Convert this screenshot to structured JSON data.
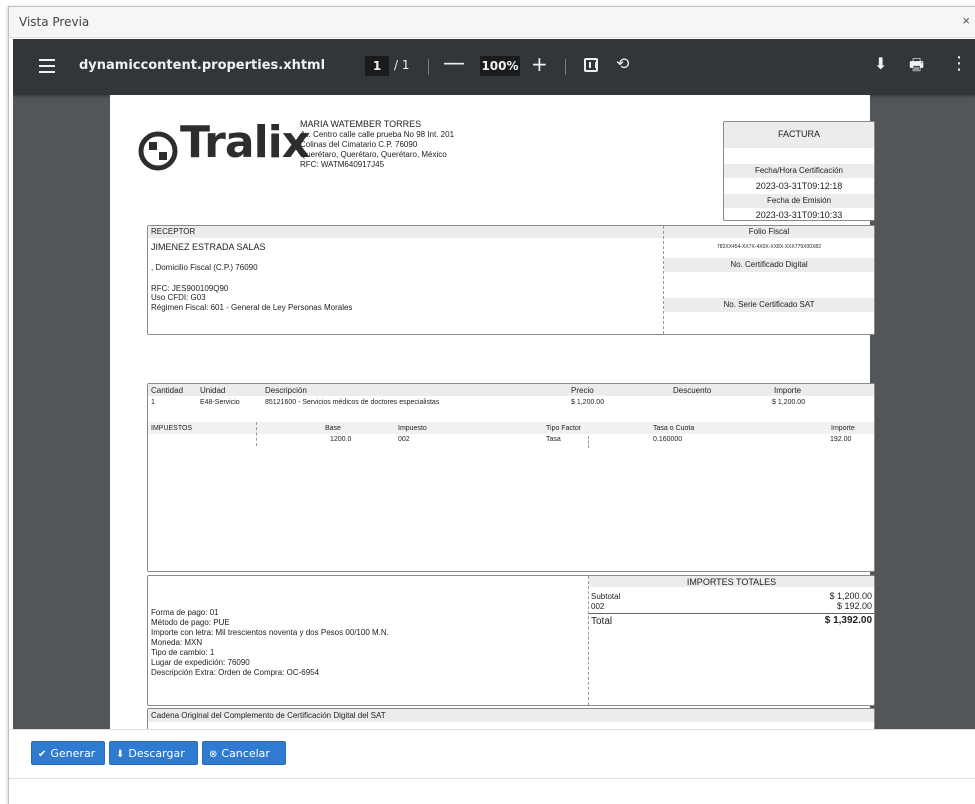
{
  "dialog": {
    "title": "Vista Previa",
    "close": "×"
  },
  "viewer": {
    "doc_name": "dynamiccontent.properties.xhtml",
    "page_current": "1",
    "page_total": "/ 1",
    "zoom": "100%",
    "zoom_out": "—",
    "zoom_in": "+",
    "rotate": "⟲",
    "download": "⬇",
    "print": "🖶",
    "more": "⋮"
  },
  "invoice": {
    "logo_text": "Tralix",
    "issuer": {
      "name": "MARIA WATEMBER TORRES",
      "line1": "Av. Centro calle calle prueba No 98 Int. 201",
      "line2": "Colinas del Cimatario C.P. 76090",
      "line3": "Querétaro, Querétaro, Querétaro, México",
      "rfc": "RFC: WATM640917J45"
    },
    "factura_box": {
      "title": "FACTURA",
      "cert_label": "Fecha/Hora Certificación",
      "cert_value": "2023-03-31T09:12:18",
      "emision_label": "Fecha de Emisión",
      "emision_value": "2023-03-31T09:10:33"
    },
    "receptor": {
      "header": "RECEPTOR",
      "name": "JIMENEZ ESTRADA SALAS",
      "domicilio": ", Domicilio Fiscal (C.P.) 76090",
      "rfc": "RFC: JES900109Q90",
      "uso": "Uso CFDI: G03",
      "regimen": "Régimen Fiscal: 601 - General de Ley Personas Morales",
      "folio_label": "Folio Fiscal",
      "folio_value": "782XX454-XX7X-4X0X-XX8X-XXX779X00X82",
      "cert_digital_label": "No. Certificado Digital",
      "serie_sat_label": "No. Serie Certificado SAT"
    },
    "conceptos": {
      "headers": [
        "Cantidad",
        "Unidad",
        "Descripción",
        "Precio",
        "Descuento",
        "Importe"
      ],
      "row": [
        "1",
        "E48-Servicio",
        "85121600 - Servicios médicos de doctores especialistas",
        "$ 1,200.00",
        "",
        "$ 1,200.00"
      ]
    },
    "impuestos": {
      "headers": [
        "IMPUESTOS",
        "Base",
        "Impuesto",
        "Tipo Factor",
        "Tasa o Cuota",
        "Importe"
      ],
      "row": [
        "",
        "1200.0",
        "002",
        "Tasa",
        "0.160000",
        "192.00"
      ]
    },
    "pago": {
      "forma": "Forma de pago: 01",
      "metodo": "Método de pago: PUE",
      "letra": "Importe con letra: Mil trescientos noventa y dos Pesos 00/100 M.N.",
      "moneda": "Moneda: MXN",
      "cambio": "Tipo de cambio: 1",
      "lugar": "Lugar de expedición: 76090",
      "extra": "Descripción Extra:     Orden de Compra: OC-6954"
    },
    "totales": {
      "header": "IMPORTES TOTALES",
      "subtotal_label": "Subtotal",
      "subtotal_value": "$ 1,200.00",
      "iva_label": "002",
      "iva_value": "$ 192.00",
      "total_label": "Total",
      "total_value": "$ 1,392.00"
    },
    "cadena": {
      "header": "Cadena Original del Complemento de Certificación Digital del SAT"
    }
  },
  "footer": {
    "generar": "Generar",
    "descargar": "Descargar",
    "cancelar": "Cancelar"
  }
}
